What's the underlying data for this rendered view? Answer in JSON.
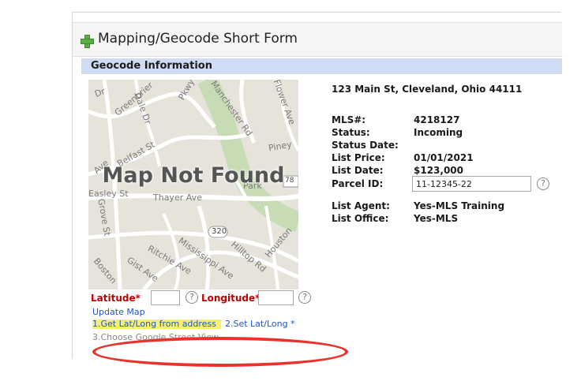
{
  "form": {
    "title": "Mapping/Geocode Short Form",
    "section_title": "Geocode Information"
  },
  "map": {
    "message": "Map Not Found",
    "street_labels": [
      "Dr",
      "Dale Dr",
      "Greenbrier",
      "Pkwy",
      "Manchester Rd",
      "Flower Ave",
      "Belfast St",
      "Piney",
      "Ave",
      "Easley St",
      "Thayer Ave",
      "Park",
      "Grove St",
      "320",
      "Mississippi Ave",
      "Ritchie Ave",
      "Hilltop Rd",
      "Houston",
      "Gist Ave",
      "Boston",
      "78"
    ]
  },
  "geocode": {
    "latitude_label": "Latitude*",
    "latitude_value": "",
    "longitude_label": "Longitude*",
    "longitude_value": "",
    "help_symbol": "?"
  },
  "links": {
    "update_map": "Update Map",
    "step1": "1.Get Lat/Long from address",
    "step2": "2.Set Lat/Long *",
    "step3": "3.Choose Google Street View"
  },
  "listing": {
    "address": "123 Main St, Cleveland, Ohio 44111",
    "mls_label": "MLS#:",
    "mls_value": "4218127",
    "status_label": "Status:",
    "status_value": "Incoming",
    "status_date_label": "Status Date:",
    "status_date_value": "",
    "list_price_label": "List Price:",
    "list_price_value": "01/01/2021",
    "list_date_label": "List Date:",
    "list_date_value": "$123,000",
    "parcel_label": "Parcel ID:",
    "parcel_value": "11-12345-22",
    "agent_label": "List Agent:",
    "agent_value": "Yes-MLS Training",
    "office_label": "List Office:",
    "office_value": "Yes-MLS"
  },
  "colors": {
    "accent": "#1f56c9",
    "required": "#c00000",
    "section_header": "#cfdcf3",
    "annotation": "#e8332d",
    "highlight": "#f6f06c"
  }
}
